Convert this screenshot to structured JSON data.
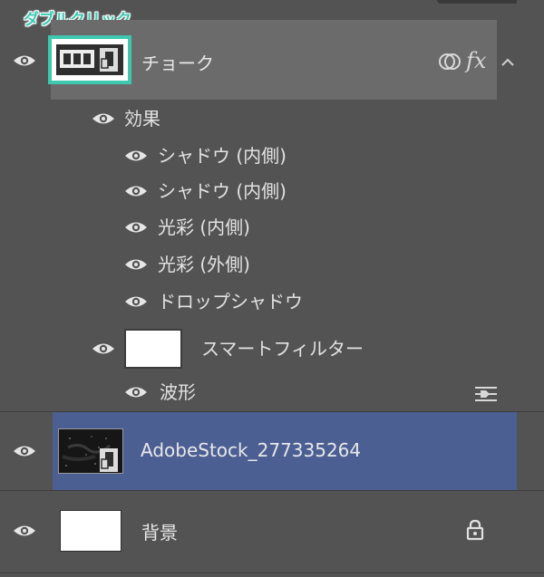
{
  "annotation": {
    "text": "ダブルクリック"
  },
  "layers": {
    "chalk": {
      "name": "チョーク"
    },
    "effects_header": {
      "label": "効果"
    },
    "effects": [
      {
        "label": "シャドウ (内側)"
      },
      {
        "label": "シャドウ (内側)"
      },
      {
        "label": "光彩 (内側)"
      },
      {
        "label": "光彩 (外側)"
      },
      {
        "label": "ドロップシャドウ"
      }
    ],
    "smart_filters": {
      "label": "スマートフィルター"
    },
    "filters": [
      {
        "label": "波形"
      }
    ],
    "stock": {
      "name": "AdobeStock_277335264"
    },
    "background": {
      "name": "背景"
    }
  },
  "icons": {
    "visibility": "eye-icon",
    "effects": "fx-icon",
    "blend": "overlap-circles-icon",
    "expand": "chevron-up-icon",
    "smart_object": "smart-object-icon",
    "filter_options": "filter-options-icon",
    "lock": "lock-icon"
  },
  "colors": {
    "panel_bg": "#535353",
    "selected_layer": "#4b5f93",
    "highlight_layer": "#6b6b6b",
    "annotation": "#3ec8b0",
    "text": "#e4e4e4"
  }
}
